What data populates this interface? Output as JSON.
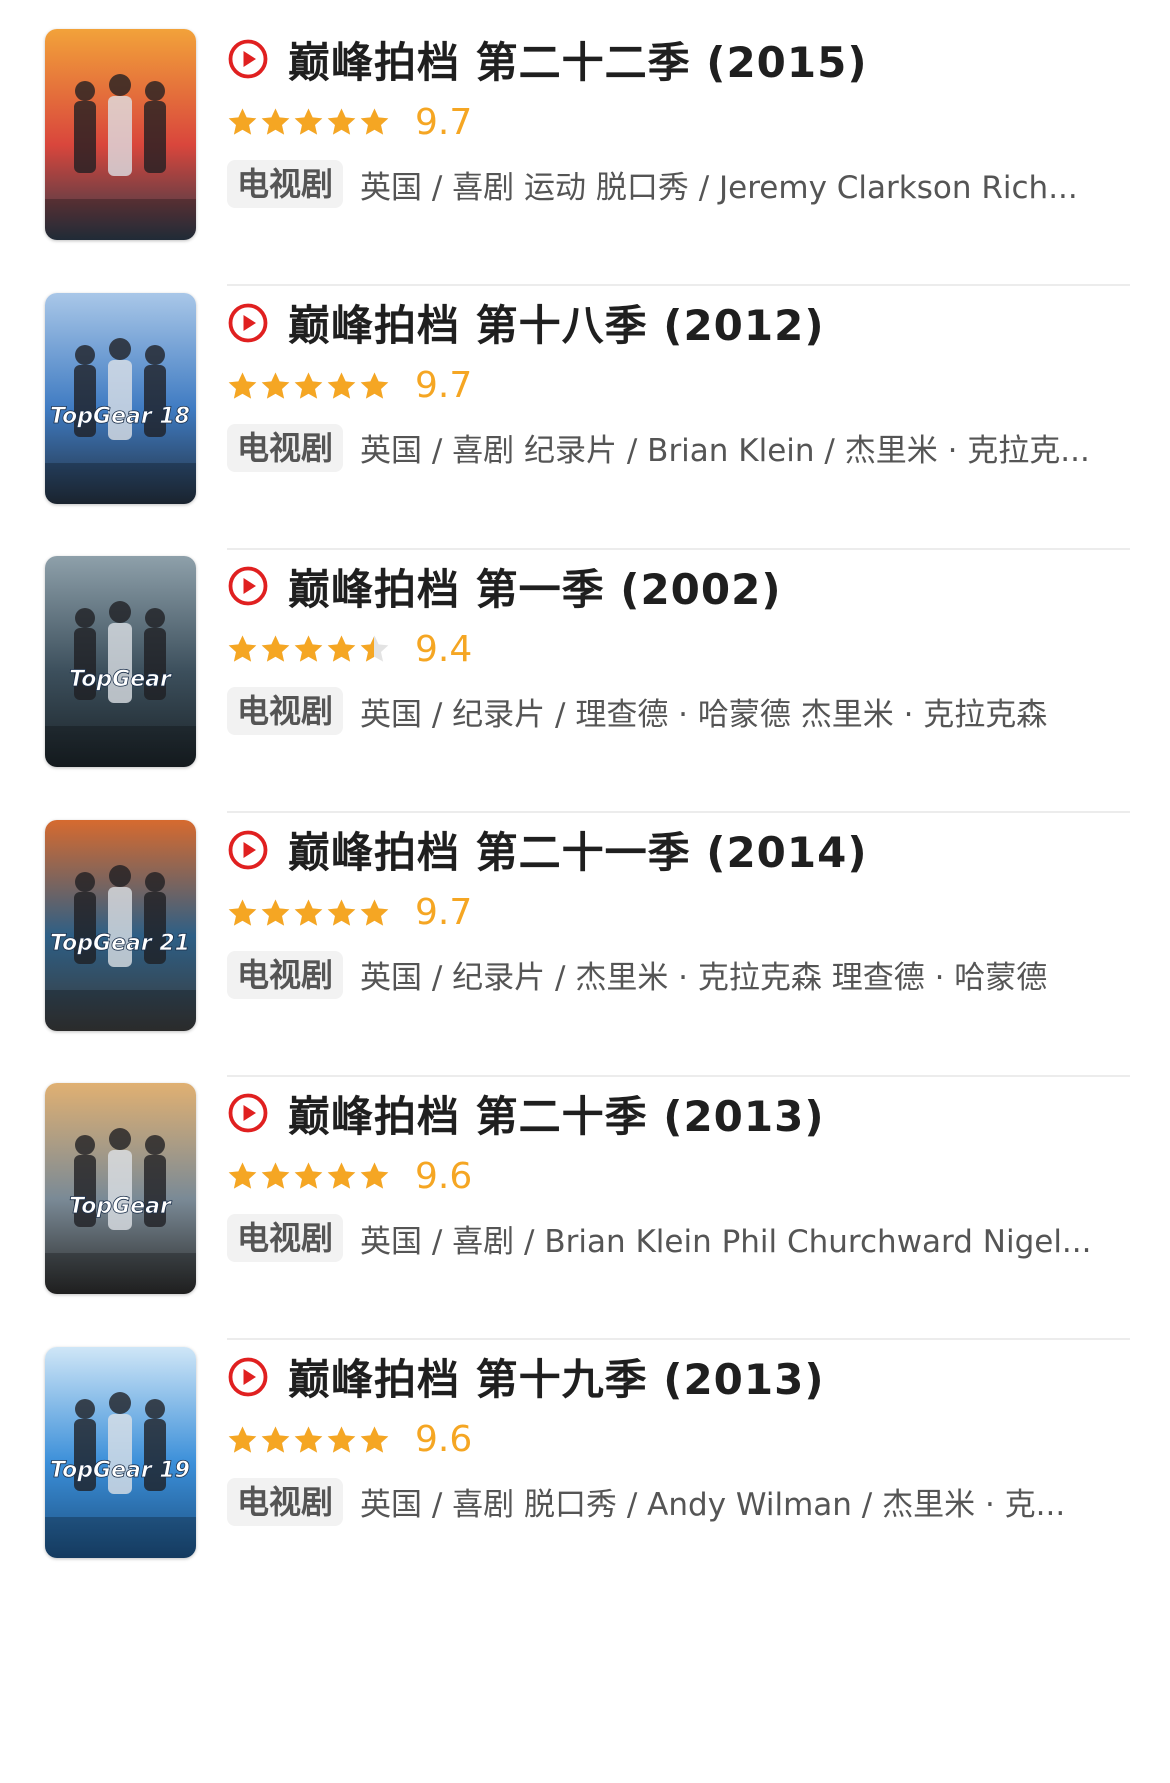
{
  "accent_color": "#e02020",
  "star_color": "#f5a623",
  "items": [
    {
      "title": "巅峰拍档 第二十二季 (2015)",
      "rating": 9.7,
      "rating_text": "9.7",
      "stars_fraction": 1.0,
      "tag": "电视剧",
      "meta": "英国 / 喜剧 运动 脱口秀 / Jeremy Clarkson Rich...",
      "poster": {
        "art_text": "",
        "palette": [
          "#d9463c",
          "#f2a23a",
          "#2b3a4a"
        ]
      }
    },
    {
      "title": "巅峰拍档 第十八季 (2012)",
      "rating": 9.7,
      "rating_text": "9.7",
      "stars_fraction": 1.0,
      "tag": "电视剧",
      "meta": "英国 / 喜剧 纪录片 / Brian Klein / 杰里米 · 克拉克...",
      "poster": {
        "art_text": "TopGear 18",
        "palette": [
          "#3f7bc2",
          "#a9c7e8",
          "#23303f"
        ]
      }
    },
    {
      "title": "巅峰拍档 第一季 (2002)",
      "rating": 9.4,
      "rating_text": "9.4",
      "stars_fraction": 0.9,
      "tag": "电视剧",
      "meta": "英国 / 纪录片 / 理查德 · 哈蒙德 杰里米 · 克拉克森",
      "poster": {
        "art_text": "TopGear",
        "palette": [
          "#3c4f5c",
          "#8ea0aa",
          "#1b2328"
        ]
      }
    },
    {
      "title": "巅峰拍档 第二十一季 (2014)",
      "rating": 9.7,
      "rating_text": "9.7",
      "stars_fraction": 1.0,
      "tag": "电视剧",
      "meta": "英国 / 纪录片 / 杰里米 · 克拉克森 理查德 · 哈蒙德",
      "poster": {
        "art_text": "TopGear 21",
        "palette": [
          "#2d5f86",
          "#d66a2f",
          "#3a3a3a"
        ]
      }
    },
    {
      "title": "巅峰拍档 第二十季 (2013)",
      "rating": 9.6,
      "rating_text": "9.6",
      "stars_fraction": 1.0,
      "tag": "电视剧",
      "meta": "英国 / 喜剧 / Brian Klein Phil Churchward Nigel...",
      "poster": {
        "art_text": "TopGear",
        "palette": [
          "#7a8a96",
          "#e0b072",
          "#2a2a2a"
        ]
      }
    },
    {
      "title": "巅峰拍档 第十九季 (2013)",
      "rating": 9.6,
      "rating_text": "9.6",
      "stars_fraction": 1.0,
      "tag": "电视剧",
      "meta": "英国 / 喜剧 脱口秀 / Andy Wilman / 杰里米 · 克...",
      "poster": {
        "art_text": "TopGear 19",
        "palette": [
          "#3b8fd9",
          "#cfe6f7",
          "#1c4f80"
        ]
      }
    }
  ]
}
